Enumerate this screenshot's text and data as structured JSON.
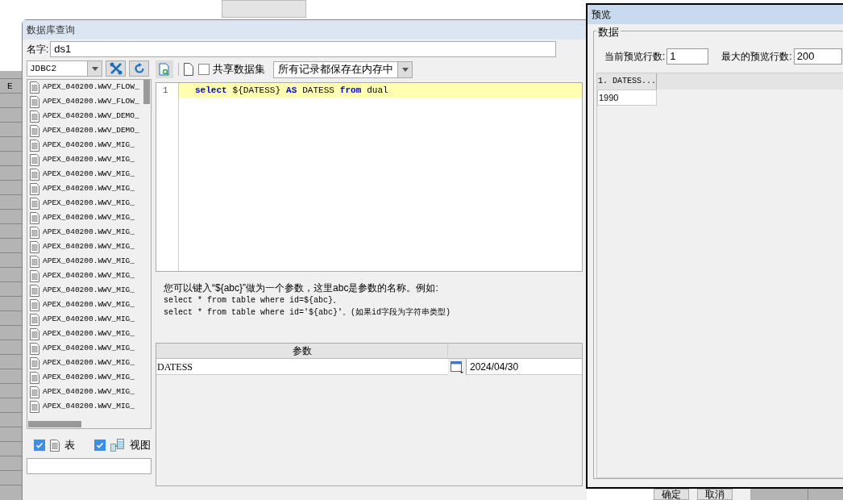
{
  "background": {
    "side_label": "E"
  },
  "query_dialog": {
    "title": "数据库查询",
    "name_label": "名字:",
    "name_value": "ds1",
    "connection": "JDBC2",
    "tables": [
      "APEX_040200.WWV_FLOW_",
      "APEX_040200.WWV_FLOW_",
      "APEX_040200.WWV_DEMO_",
      "APEX_040200.WWV_DEMO_",
      "APEX_040200.WWV_MIG_",
      "APEX_040200.WWV_MIG_",
      "APEX_040200.WWV_MIG_",
      "APEX_040200.WWV_MIG_",
      "APEX_040200.WWV_MIG_",
      "APEX_040200.WWV_MIG_",
      "APEX_040200.WWV_MIG_",
      "APEX_040200.WWV_MIG_",
      "APEX_040200.WWV_MIG_",
      "APEX_040200.WWV_MIG_",
      "APEX_040200.WWV_MIG_",
      "APEX_040200.WWV_MIG_",
      "APEX_040200.WWV_MIG_",
      "APEX_040200.WWV_MIG_",
      "APEX_040200.WWV_MIG_",
      "APEX_040200.WWV_MIG_",
      "APEX_040200.WWV_MIG_",
      "APEX_040200.WWV_MIG_",
      "APEX_040200.WWV_MIG_"
    ],
    "filters": [
      {
        "kind": "table",
        "label": "表",
        "checked": true
      },
      {
        "kind": "view",
        "label": "视图",
        "checked": true
      }
    ],
    "share_checkbox": {
      "label": "共享数据集",
      "checked": false
    },
    "storage_mode": "所有记录都保存在内存中",
    "editor": {
      "lines": [
        {
          "number": "1",
          "tokens": [
            {
              "kind": "keyword",
              "text": "select"
            },
            {
              "kind": "text",
              "text": "${DATESS}"
            },
            {
              "kind": "keyword",
              "text": "AS"
            },
            {
              "kind": "text",
              "text": "DATESS"
            },
            {
              "kind": "keyword",
              "text": "from"
            },
            {
              "kind": "text",
              "text": "dual"
            }
          ]
        }
      ]
    },
    "hint": [
      "您可以键入“${abc}”做为一个参数，这里abc是参数的名称。例如:",
      "select * from table where id=${abc}。",
      "select * from table where id='${abc}'。(如果id字段为字符串类型)"
    ],
    "params": {
      "columns": [
        "参数"
      ],
      "rows": [
        {
          "name": "DATESS",
          "value": "2024/04/30"
        }
      ]
    },
    "buttons": [
      "确定",
      "取消"
    ]
  },
  "preview_dialog": {
    "title": "预览",
    "group": "数据",
    "current_rows_label": "当前预览行数:",
    "current_rows": "1",
    "max_rows_label": "最大的预览行数:",
    "max_rows": "200",
    "columns": [
      "1. DATESS..."
    ],
    "rows": [
      [
        "1990"
      ]
    ]
  }
}
